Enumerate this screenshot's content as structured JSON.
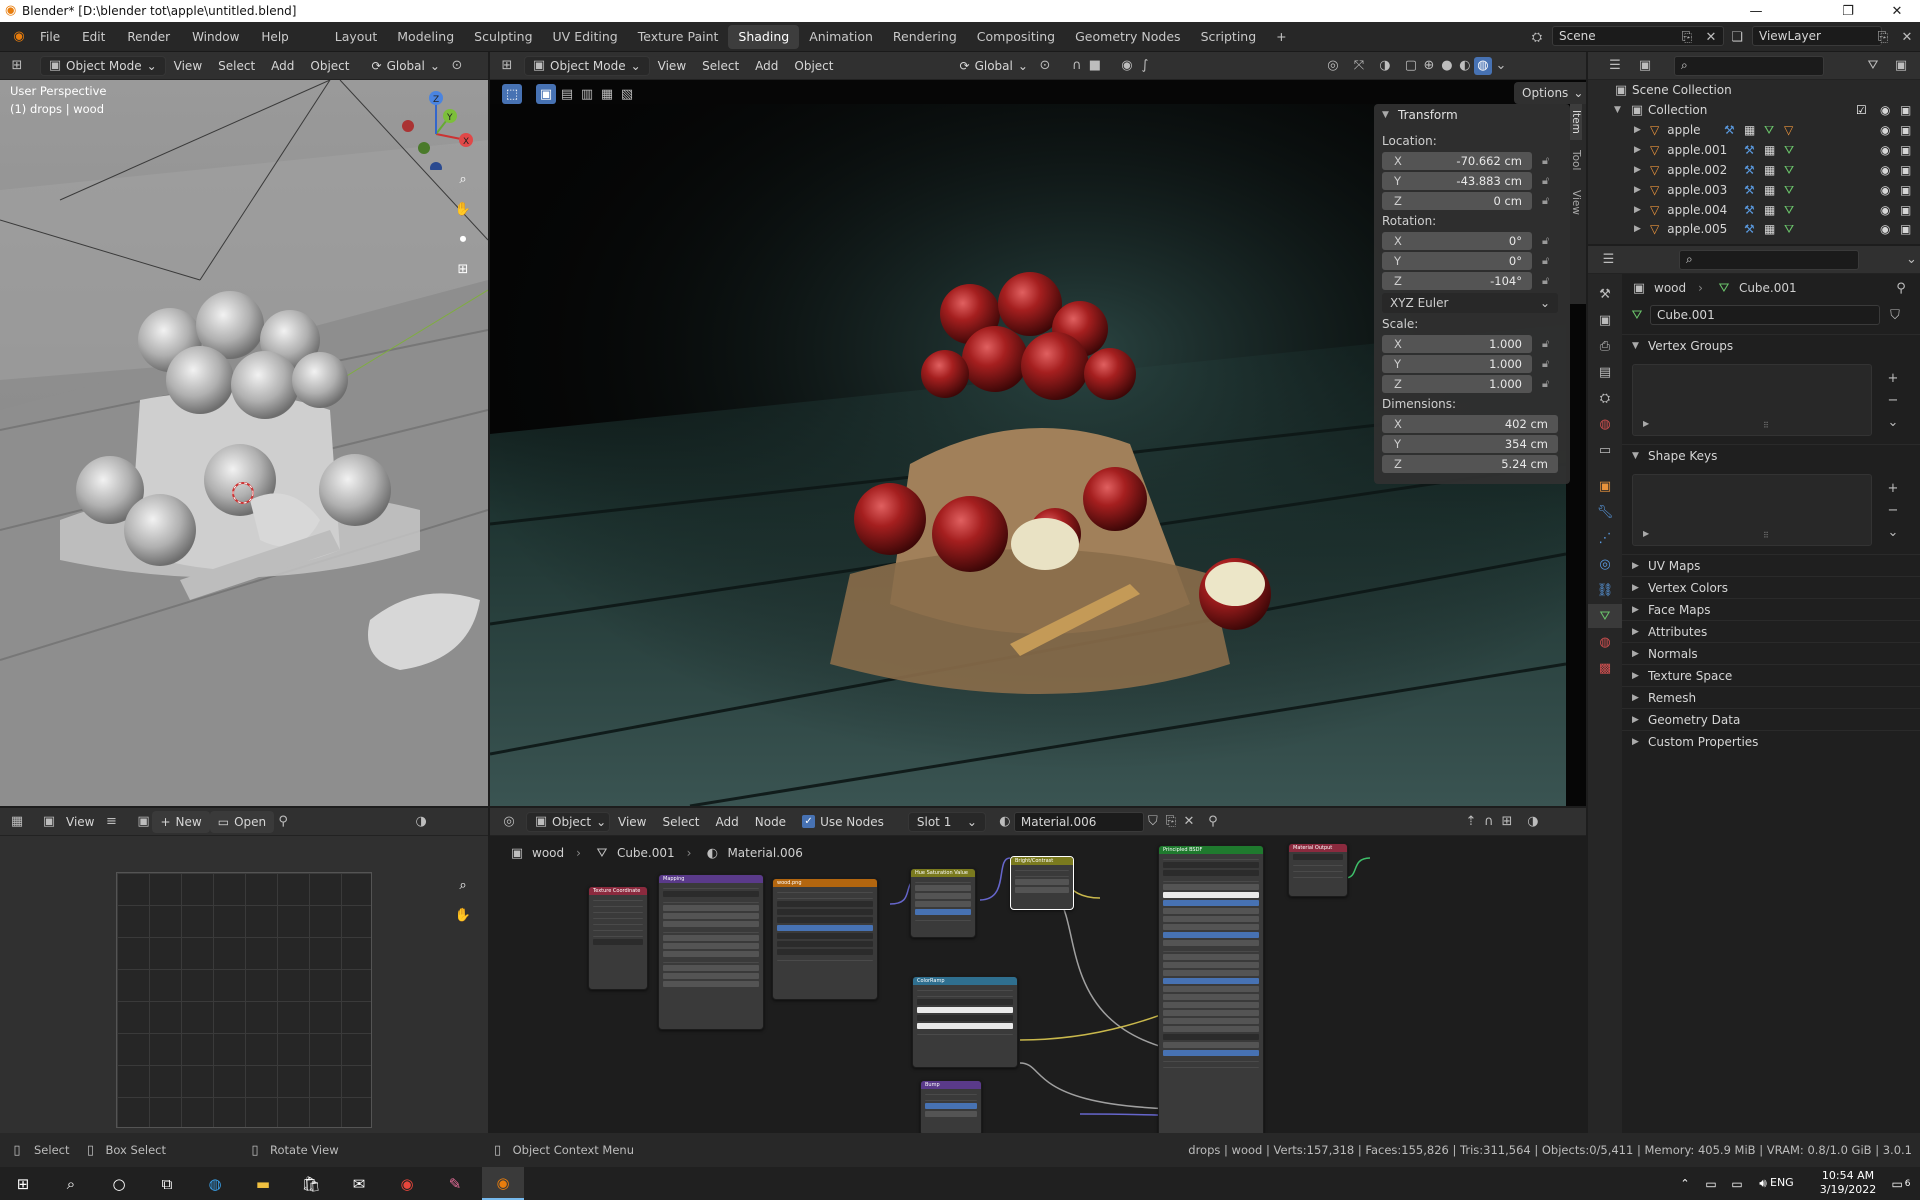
{
  "window": {
    "title": "Blender* [D:\\blender tot\\apple\\untitled.blend]"
  },
  "topbar": {
    "menus": [
      "File",
      "Edit",
      "Render",
      "Window",
      "Help"
    ],
    "workspaces": [
      "Layout",
      "Modeling",
      "Sculpting",
      "UV Editing",
      "Texture Paint",
      "Shading",
      "Animation",
      "Rendering",
      "Compositing",
      "Geometry Nodes",
      "Scripting"
    ],
    "active_workspace": "Shading",
    "add_tab": "+",
    "scene": "Scene",
    "view_layer": "ViewLayer"
  },
  "left_viewport": {
    "mode": "Object Mode",
    "menus": [
      "View",
      "Select",
      "Add",
      "Object"
    ],
    "orientation": "Global",
    "overlay_title": "User Perspective",
    "overlay_sub": "(1) drops | wood",
    "gizmo_axes": [
      "X",
      "Y",
      "Z"
    ]
  },
  "main_viewport": {
    "mode": "Object Mode",
    "menus": [
      "View",
      "Select",
      "Add",
      "Object"
    ],
    "orientation": "Global",
    "options": "Options",
    "side_tabs": [
      "Item",
      "Tool",
      "View"
    ],
    "transform": {
      "title": "Transform",
      "location_label": "Location:",
      "location": [
        {
          "axis": "X",
          "value": "-70.662 cm"
        },
        {
          "axis": "Y",
          "value": "-43.883 cm"
        },
        {
          "axis": "Z",
          "value": "0 cm"
        }
      ],
      "rotation_label": "Rotation:",
      "rotation": [
        {
          "axis": "X",
          "value": "0°"
        },
        {
          "axis": "Y",
          "value": "0°"
        },
        {
          "axis": "Z",
          "value": "-104°"
        }
      ],
      "rotation_mode": "XYZ Euler",
      "scale_label": "Scale:",
      "scale": [
        {
          "axis": "X",
          "value": "1.000"
        },
        {
          "axis": "Y",
          "value": "1.000"
        },
        {
          "axis": "Z",
          "value": "1.000"
        }
      ],
      "dimensions_label": "Dimensions:",
      "dimensions": [
        {
          "axis": "X",
          "value": "402 cm"
        },
        {
          "axis": "Y",
          "value": "354 cm"
        },
        {
          "axis": "Z",
          "value": "5.24 cm"
        }
      ]
    }
  },
  "image_editor": {
    "view": "View",
    "new": "New",
    "open": "Open"
  },
  "node_editor": {
    "editor_type": "Object",
    "menus": [
      "View",
      "Select",
      "Add",
      "Node"
    ],
    "use_nodes": "Use Nodes",
    "slot": "Slot 1",
    "material": "Material.006",
    "breadcrumb": [
      "wood",
      "Cube.001",
      "Material.006"
    ],
    "nodes": [
      {
        "title": "Texture Coordinate",
        "color": "#8b2a3e"
      },
      {
        "title": "Mapping",
        "color": "#5a3a8a"
      },
      {
        "title": "wood.png",
        "color": "#b3660f"
      },
      {
        "title": "Hue Saturation Value",
        "color": "#7a7a1e"
      },
      {
        "title": "Bright/Contrast",
        "color": "#7a7a1e"
      },
      {
        "title": "Principled BSDF",
        "color": "#1f7a2e"
      },
      {
        "title": "Material Output",
        "color": "#8b2a3e"
      },
      {
        "title": "ColorRamp",
        "color": "#2f6f8f"
      },
      {
        "title": "Bump",
        "color": "#5a3a8a"
      }
    ]
  },
  "outliner": {
    "root": "Scene Collection",
    "collection": "Collection",
    "items": [
      "apple",
      "apple.001",
      "apple.002",
      "apple.003",
      "apple.004",
      "apple.005"
    ]
  },
  "properties": {
    "breadcrumb_object": "wood",
    "breadcrumb_data": "Cube.001",
    "data_name": "Cube.001",
    "sections_open": [
      "Vertex Groups",
      "Shape Keys"
    ],
    "sections_closed": [
      "UV Maps",
      "Vertex Colors",
      "Face Maps",
      "Attributes",
      "Normals",
      "Texture Space",
      "Remesh",
      "Geometry Data",
      "Custom Properties"
    ]
  },
  "statusbar": {
    "select": "Select",
    "box_select": "Box Select",
    "rotate_view": "Rotate View",
    "context_menu": "Object Context Menu",
    "stats": "drops | wood | Verts:157,318 | Faces:155,826 | Tris:311,564 | Objects:0/5,411 | Memory: 405.9 MiB | VRAM: 0.8/1.0 GiB | 3.0.1"
  },
  "taskbar": {
    "time": "10:54 AM",
    "date": "3/19/2022",
    "lang": "ENG",
    "notifications": "6"
  }
}
